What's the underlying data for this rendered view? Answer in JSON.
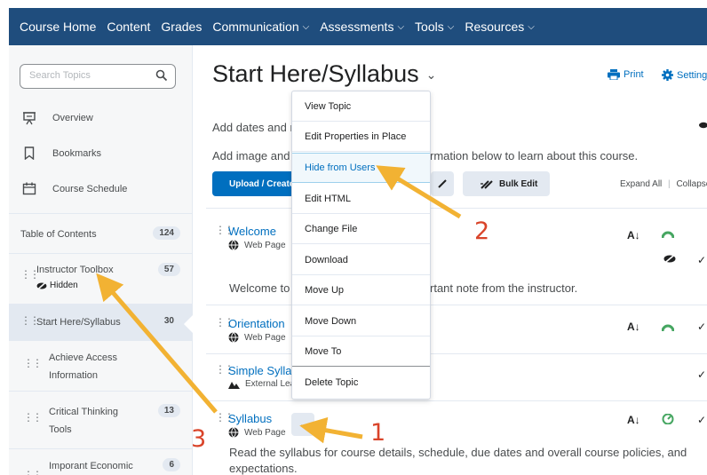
{
  "nav": {
    "items": [
      {
        "label": "Course Home",
        "caret": false
      },
      {
        "label": "Content",
        "caret": false
      },
      {
        "label": "Grades",
        "caret": false
      },
      {
        "label": "Communication",
        "caret": true
      },
      {
        "label": "Assessments",
        "caret": true
      },
      {
        "label": "Tools",
        "caret": true
      },
      {
        "label": "Resources",
        "caret": true
      }
    ],
    "bg_color": "#1f4d7d"
  },
  "sidebar": {
    "search_placeholder": "Search Topics",
    "links": [
      "Overview",
      "Bookmarks",
      "Course Schedule"
    ],
    "toc_label": "Table of Contents",
    "toc_count": "124",
    "items": [
      {
        "line1": "Instructor Toolbox",
        "line2": "",
        "count": "57",
        "status": "Hidden"
      },
      {
        "line1": "Start Here/Syllabus",
        "line2": "",
        "count": "30",
        "status": ""
      },
      {
        "line1": "Achieve Access",
        "line2": "Information",
        "count": "",
        "status": ""
      },
      {
        "line1": "Critical Thinking",
        "line2": "Tools",
        "count": "13",
        "status": ""
      },
      {
        "line1": "Imporant Economic",
        "line2": "",
        "count": "6",
        "status": ""
      }
    ]
  },
  "main": {
    "title": "Start Here/Syllabus",
    "print_label": "Print",
    "settings_label": "Settings",
    "desc1": "Add dates and r",
    "desc2_left": "Add image and",
    "desc2_right": "rmation below to learn about this course.",
    "upload_label": "Upload / Create",
    "bulk_edit_label": "Bulk Edit",
    "expand_all": "Expand All",
    "collapse_all": "Collapse A",
    "topics": [
      {
        "title": "Welcome",
        "type": "Web Page",
        "body_left": "Welcome to",
        "body_right": "rtant note from the instructor."
      },
      {
        "title": "Orientation",
        "type": "Web Page"
      },
      {
        "title": "Simple Syllab",
        "type": "External Lea"
      },
      {
        "title": "Syllabus",
        "type": "Web Page",
        "body": "Read the syllabus for course details, schedule, due dates and overall course policies, and",
        "body2": "expectations."
      }
    ]
  },
  "menu": {
    "items": [
      "View Topic",
      "Edit Properties in Place",
      "Hide from Users",
      "Edit HTML",
      "Change File",
      "Download",
      "Move Up",
      "Move Down",
      "Move To",
      "Delete Topic"
    ],
    "highlighted": "Hide from Users"
  },
  "annotations": {
    "n1": "1",
    "n2": "2",
    "n3": "3",
    "arrow_color": "#f2b233",
    "number_color": "#d9442a"
  }
}
